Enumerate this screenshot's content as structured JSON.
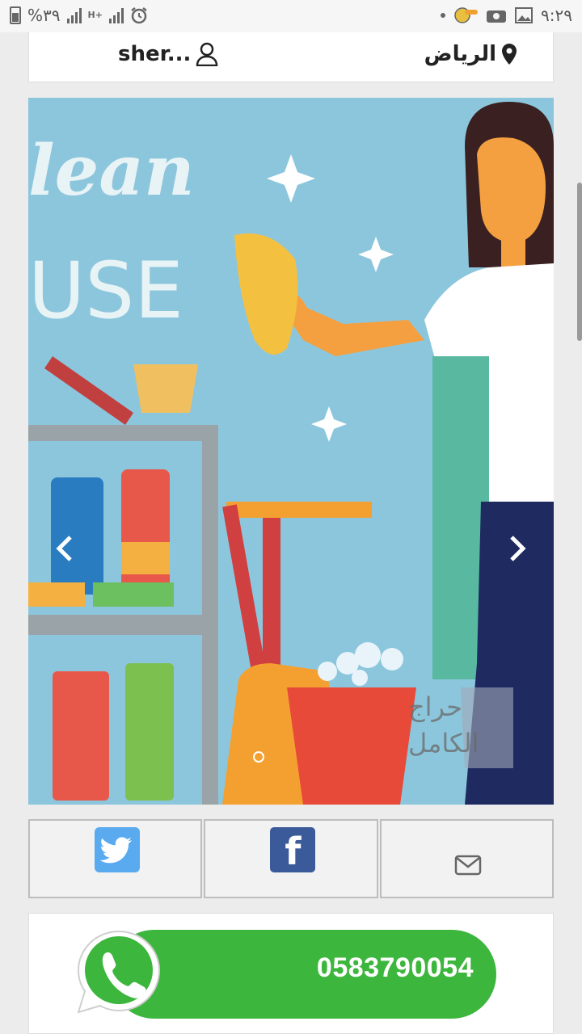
{
  "status_bar": {
    "battery_percent": "%٣٩",
    "network_type": "H+",
    "time": "٩:٢٩"
  },
  "info": {
    "location": "الرياض",
    "username": "sher..."
  },
  "slider": {
    "image_alt": "cleaning illustration",
    "image_text_top": "lean",
    "image_text_bottom": "USE",
    "watermark_line1": "حراج",
    "watermark_line2": "الكامل",
    "slide_count": 1,
    "active_slide": 1
  },
  "share": {
    "icons": [
      "twitter-icon",
      "facebook-icon",
      "mail-icon"
    ]
  },
  "whatsapp": {
    "phone": "0583790054"
  },
  "colors": {
    "whatsapp_green": "#3cb63c",
    "twitter_blue": "#5aaaf0",
    "facebook_blue": "#3b5a9a"
  }
}
